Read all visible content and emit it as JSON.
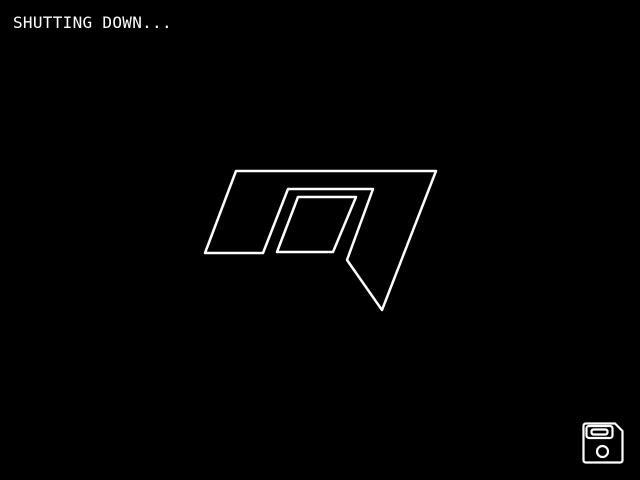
{
  "screen": {
    "status_text": "SHUTTING DOWN...",
    "logo_icon": "angular-outline-logo-icon",
    "save_icon": "floppy-disk-save-icon",
    "foreground_color": "#ffffff",
    "background_color": "#000000"
  }
}
